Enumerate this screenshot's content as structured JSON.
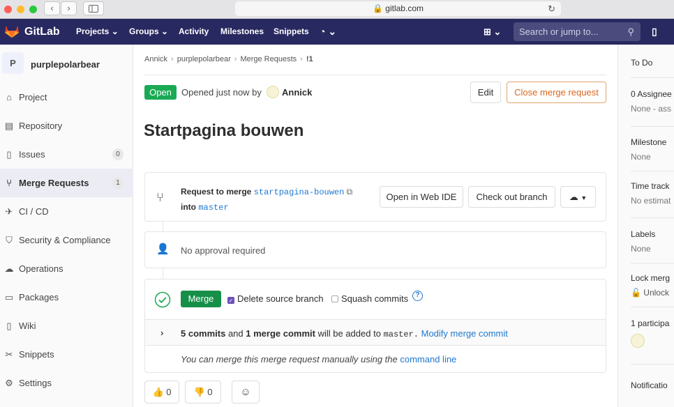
{
  "browser": {
    "url": "gitlab.com",
    "back_glyph": "‹",
    "forward_glyph": "›"
  },
  "header": {
    "brand": "GitLab",
    "nav": [
      "Projects",
      "Groups",
      "Activity",
      "Milestones",
      "Snippets"
    ],
    "search_placeholder": "Search or jump to..."
  },
  "sidebar": {
    "project_initial": "P",
    "project_name": "purplepolarbear",
    "items": [
      {
        "label": "Project",
        "icon": "home-icon"
      },
      {
        "label": "Repository",
        "icon": "book-icon"
      },
      {
        "label": "Issues",
        "icon": "issues-icon",
        "count": "0"
      },
      {
        "label": "Merge Requests",
        "icon": "git-merge-icon",
        "count": "1",
        "active": true
      },
      {
        "label": "CI / CD",
        "icon": "rocket-icon"
      },
      {
        "label": "Security & Compliance",
        "icon": "shield-icon"
      },
      {
        "label": "Operations",
        "icon": "cloud-gear-icon"
      },
      {
        "label": "Packages",
        "icon": "package-icon"
      },
      {
        "label": "Wiki",
        "icon": "book-icon"
      },
      {
        "label": "Snippets",
        "icon": "scissors-icon"
      },
      {
        "label": "Settings",
        "icon": "gear-icon"
      }
    ]
  },
  "breadcrumb": [
    "Annick",
    "purplepolarbear",
    "Merge Requests",
    "!1"
  ],
  "mr": {
    "status": "Open",
    "opened_text": "Opened just now by",
    "author": "Annick",
    "edit_label": "Edit",
    "close_label": "Close merge request",
    "title": "Startpagina bouwen",
    "request_to_merge": "Request to merge",
    "source_branch": "startpagina-bouwen",
    "into": "into",
    "target_branch": "master",
    "open_web_ide": "Open in Web IDE",
    "check_out_branch": "Check out branch",
    "approval": "No approval required",
    "merge_button": "Merge",
    "delete_source_branch": "Delete source branch",
    "squash_commits": "Squash commits",
    "commits_count": "5 commits",
    "and": "and",
    "merge_commit": "1 merge commit",
    "will_be_added": "will be added to",
    "target_period": "master.",
    "modify_merge_commit": "Modify merge commit",
    "manual_merge_text": "You can merge this merge request manually using the",
    "command_line": "command line",
    "thumbs_up_count": "0",
    "thumbs_down_count": "0"
  },
  "right_sidebar": {
    "todo": "To Do",
    "assignee_title": "0 Assignee",
    "assignee_value": "None - ass",
    "milestone_title": "Milestone",
    "milestone_value": "None",
    "time_title": "Time track",
    "time_value": "No estimat",
    "labels_title": "Labels",
    "labels_value": "None",
    "lock_title": "Lock merg",
    "lock_value": "Unlock",
    "participants": "1 participa",
    "notifications": "Notificatio"
  }
}
